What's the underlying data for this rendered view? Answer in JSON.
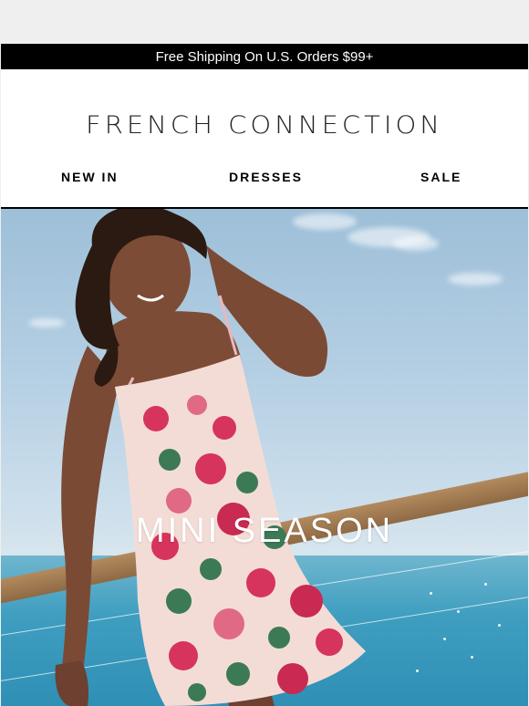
{
  "promo": {
    "text": "Free Shipping On U.S. Orders $99+"
  },
  "header": {
    "logo": "FRENCH CONNECTION",
    "nav": [
      {
        "label": "NEW IN"
      },
      {
        "label": "DRESSES"
      },
      {
        "label": "SALE"
      }
    ]
  },
  "hero": {
    "title": "MINI SEASON",
    "image_subject": "model-in-floral-mini-dress"
  },
  "colors": {
    "promo_bg": "#000000",
    "sky": "#b6d0e4",
    "sea": "#3f9ec0",
    "dress_base": "#f4dcd6",
    "dress_floral": "#d6345c"
  }
}
